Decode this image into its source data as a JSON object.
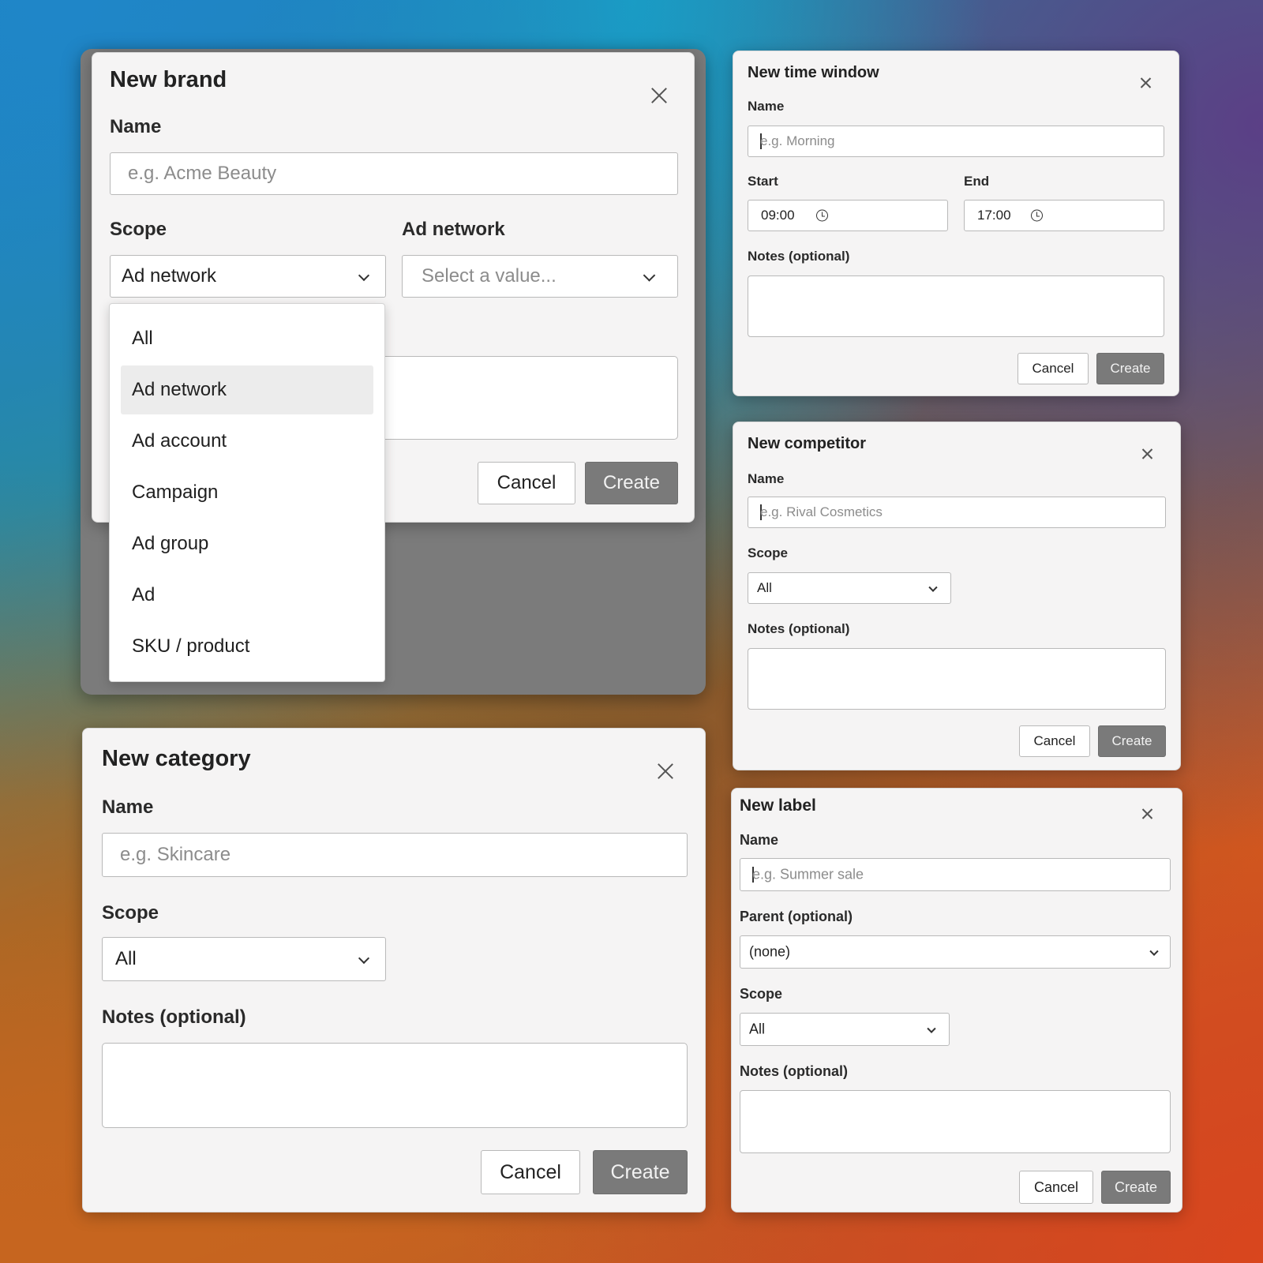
{
  "brand_dialog": {
    "title": "New brand",
    "name_label": "Name",
    "name_placeholder": "e.g. Acme Beauty",
    "scope_label": "Scope",
    "scope_value": "Ad network",
    "ad_network_label": "Ad network",
    "ad_network_placeholder": "Select a value...",
    "cancel": "Cancel",
    "create": "Create",
    "scope_options": [
      "All",
      "Ad network",
      "Ad account",
      "Campaign",
      "Ad group",
      "Ad",
      "SKU / product"
    ],
    "selected_option": "Ad network"
  },
  "time_window_dialog": {
    "title": "New time window",
    "name_label": "Name",
    "name_placeholder": "e.g. Morning",
    "start_label": "Start",
    "start_value": "09:00",
    "end_label": "End",
    "end_value": "17:00",
    "notes_label": "Notes (optional)",
    "cancel": "Cancel",
    "create": "Create"
  },
  "competitor_dialog": {
    "title": "New competitor",
    "name_label": "Name",
    "name_placeholder": "e.g. Rival Cosmetics",
    "scope_label": "Scope",
    "scope_value": "All",
    "notes_label": "Notes (optional)",
    "cancel": "Cancel",
    "create": "Create"
  },
  "category_dialog": {
    "title": "New category",
    "name_label": "Name",
    "name_placeholder": "e.g. Skincare",
    "scope_label": "Scope",
    "scope_value": "All",
    "notes_label": "Notes (optional)",
    "cancel": "Cancel",
    "create": "Create"
  },
  "label_dialog": {
    "title": "New label",
    "name_label": "Name",
    "name_placeholder": "e.g. Summer sale",
    "parent_label": "Parent (optional)",
    "parent_value": "(none)",
    "scope_label": "Scope",
    "scope_value": "All",
    "notes_label": "Notes (optional)",
    "cancel": "Cancel",
    "create": "Create"
  },
  "icons": [
    "close-icon",
    "chevron-down-icon",
    "clock-icon"
  ],
  "colors": {
    "primary_button": "#7a7a7a",
    "dialog_bg": "#f5f4f4",
    "scrim": "#7b7b7b"
  }
}
